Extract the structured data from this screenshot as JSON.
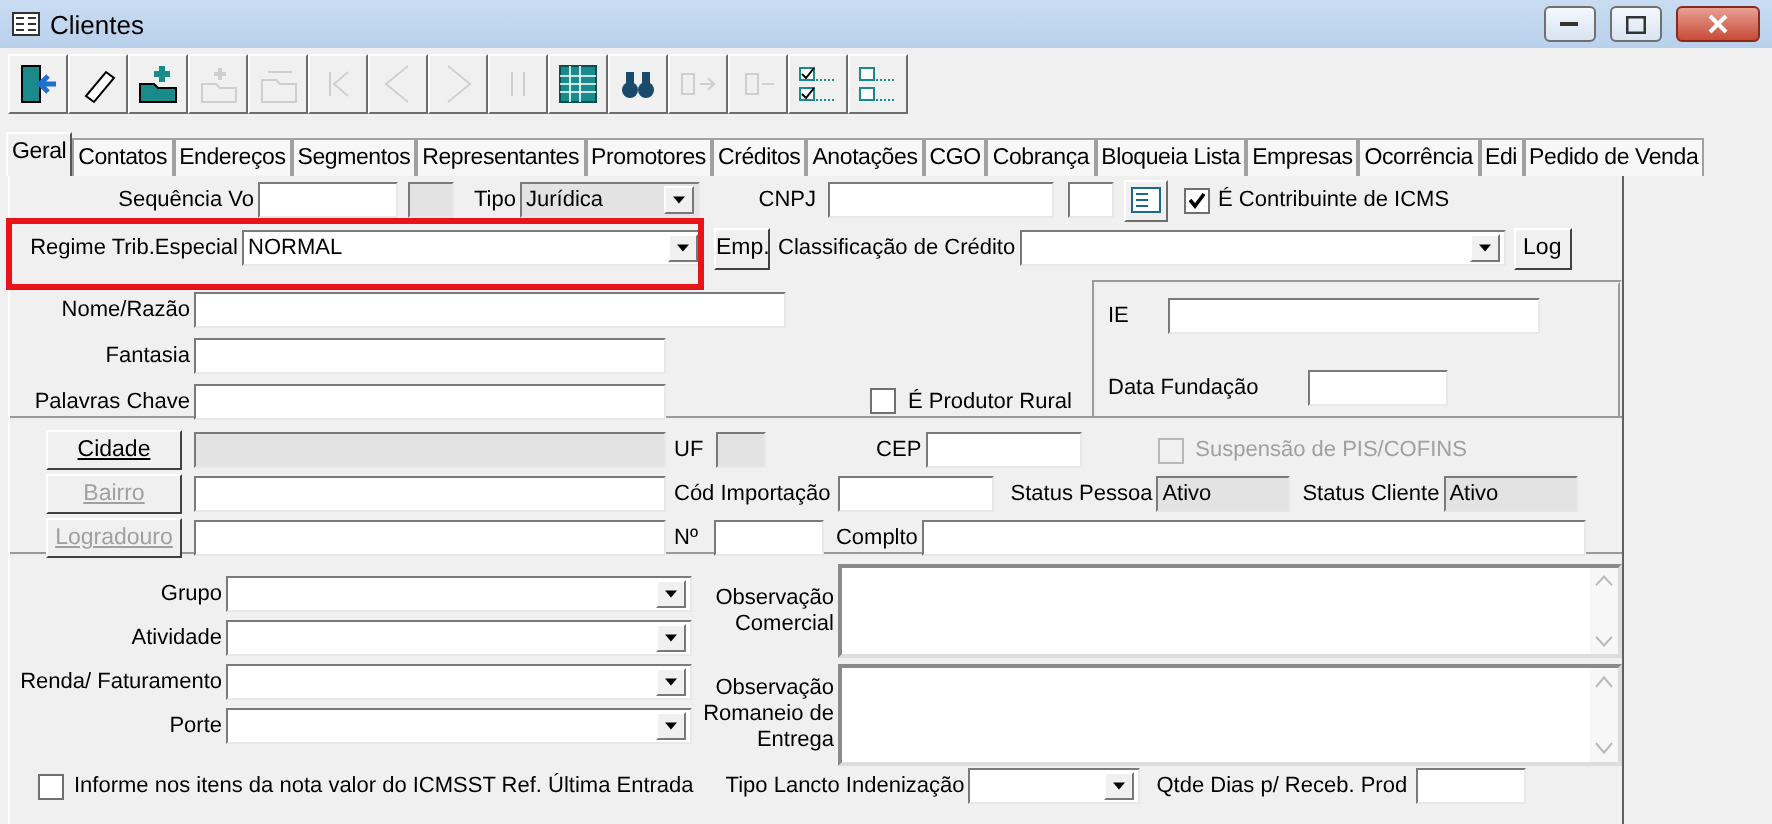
{
  "window": {
    "title": "Clientes"
  },
  "toolbar": [
    {
      "kind": "exit",
      "disabled": false
    },
    {
      "kind": "eraser",
      "disabled": false
    },
    {
      "kind": "add",
      "disabled": false
    },
    {
      "kind": "insert",
      "disabled": true
    },
    {
      "kind": "copy",
      "disabled": true
    },
    {
      "kind": "first",
      "disabled": true
    },
    {
      "kind": "prev",
      "disabled": true
    },
    {
      "kind": "next",
      "disabled": true
    },
    {
      "kind": "last",
      "disabled": true
    },
    {
      "kind": "grid",
      "disabled": false
    },
    {
      "kind": "search",
      "disabled": false
    },
    {
      "kind": "move-in",
      "disabled": true
    },
    {
      "kind": "move-out",
      "disabled": true
    },
    {
      "kind": "check-all",
      "disabled": false
    },
    {
      "kind": "uncheck-all",
      "disabled": false
    }
  ],
  "tabs": [
    {
      "label": "Geral",
      "selected": true
    },
    {
      "label": "Contatos",
      "selected": false
    },
    {
      "label": "Endereços",
      "selected": false
    },
    {
      "label": "Segmentos",
      "selected": false
    },
    {
      "label": "Representantes",
      "selected": false
    },
    {
      "label": "Promotores",
      "selected": false
    },
    {
      "label": "Créditos",
      "selected": false
    },
    {
      "label": "Anotações",
      "selected": false
    },
    {
      "label": "CGO",
      "selected": false
    },
    {
      "label": "Cobrança",
      "selected": false
    },
    {
      "label": "Bloqueia Lista",
      "selected": false
    },
    {
      "label": "Empresas",
      "selected": false
    },
    {
      "label": "Ocorrência",
      "selected": false
    },
    {
      "label": "Edi",
      "selected": false
    },
    {
      "label": "Pedido de Venda",
      "selected": false
    }
  ],
  "header": {
    "sequencia_label": "Sequência Vo",
    "tipo_label": "Tipo",
    "tipo_value": "Jurídica",
    "cnpj_label": "CNPJ",
    "contribuinte": {
      "label": "É Contribuinte de ICMS",
      "checked": true
    },
    "regime_label": "Regime Trib.Especial",
    "regime_value": "NORMAL",
    "emp_button": "Emp.",
    "classificacao_label": "Classificação de Crédito",
    "log_button": "Log"
  },
  "annotation": {
    "kind": "red-box"
  },
  "identity": {
    "nome_label": "Nome/Razão",
    "fantasia_label": "Fantasia",
    "palavras_label": "Palavras Chave",
    "produtor_rural": {
      "label": "É Produtor Rural",
      "checked": false
    },
    "ie_label": "IE",
    "data_fundacao_label": "Data Fundação"
  },
  "address": {
    "cidade_button": {
      "label": "Cidade",
      "disabled": false
    },
    "bairro_button": {
      "label": "Bairro",
      "disabled": true
    },
    "logradouro_button": {
      "label": "Logradouro",
      "disabled": true
    },
    "uf_label": "UF",
    "cep_label": "CEP",
    "suspensao": {
      "label": "Suspensão de PIS/COFINS",
      "checked": false,
      "disabled": true
    },
    "cod_importacao_label": "Cód Importação",
    "status_pessoa_label": "Status Pessoa",
    "status_pessoa_value": "Ativo",
    "status_cliente_label": "Status Cliente",
    "status_cliente_value": "Ativo",
    "numero_label": "Nº",
    "complto_label": "Complto"
  },
  "classification": {
    "selects": [
      {
        "label": "Grupo"
      },
      {
        "label": "Atividade"
      },
      {
        "label": "Renda/ Faturamento"
      },
      {
        "label": "Porte"
      }
    ],
    "observations": [
      {
        "label": "Observação Comercial"
      },
      {
        "label": "Observação Romaneio de Entrega"
      }
    ]
  },
  "footer": {
    "informe": {
      "label": "Informe nos itens da nota valor do ICMSST Ref. Última Entrada",
      "checked": false
    },
    "tipo_lancto_label": "Tipo Lancto Indenização",
    "qtde_dias_label": "Qtde Dias p/ Receb. Prod"
  }
}
